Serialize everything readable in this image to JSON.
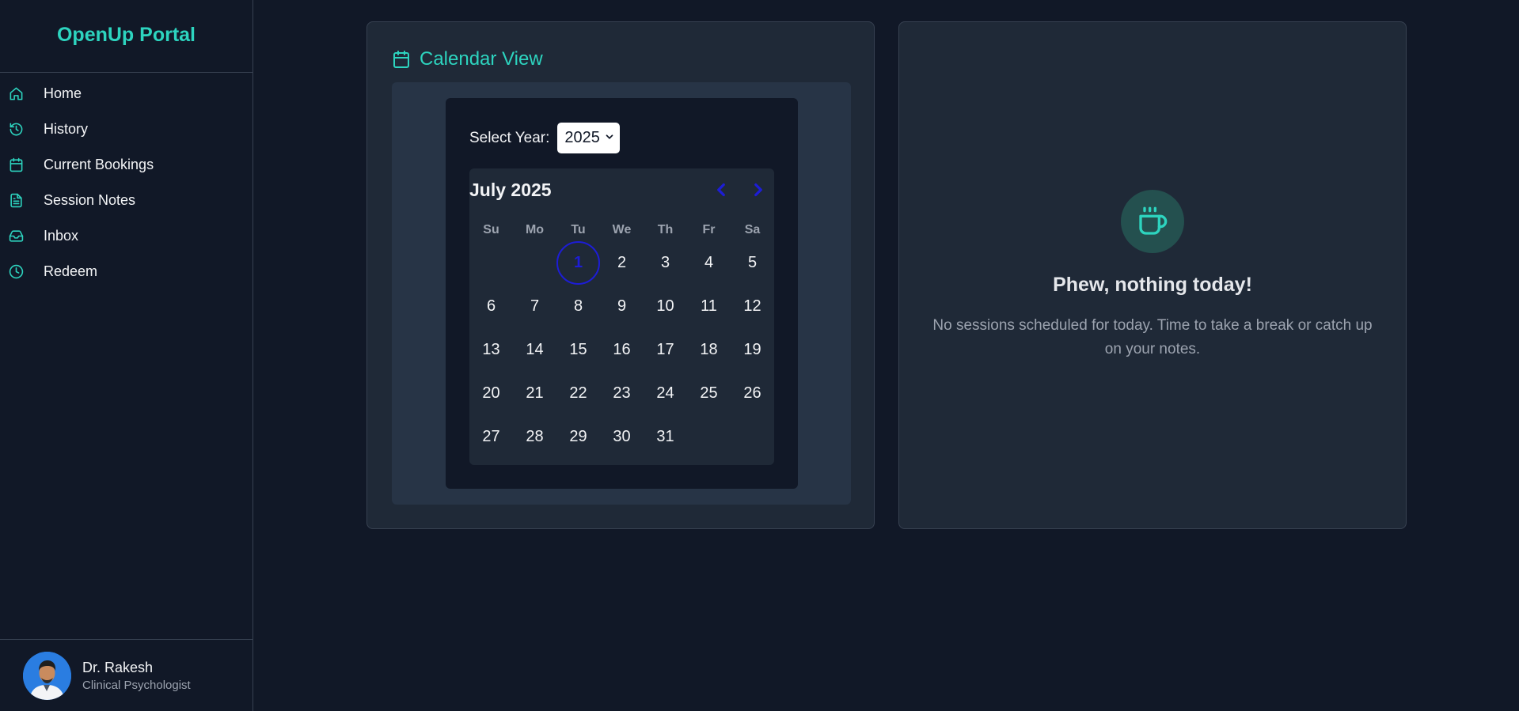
{
  "sidebar": {
    "brand": "OpenUp Portal",
    "items": [
      {
        "label": "Home",
        "icon": "home-icon"
      },
      {
        "label": "History",
        "icon": "history-icon"
      },
      {
        "label": "Current Bookings",
        "icon": "calendar-icon"
      },
      {
        "label": "Session Notes",
        "icon": "file-text-icon"
      },
      {
        "label": "Inbox",
        "icon": "inbox-icon"
      },
      {
        "label": "Redeem",
        "icon": "clock-icon"
      }
    ],
    "profile": {
      "name": "Dr. Rakesh",
      "role": "Clinical Psychologist"
    }
  },
  "calendar_card": {
    "title": "Calendar View",
    "year_label": "Select Year:",
    "year_value": "2025",
    "month_title": "July 2025",
    "weekdays": [
      "Su",
      "Mo",
      "Tu",
      "We",
      "Th",
      "Fr",
      "Sa"
    ],
    "first_weekday_index": 2,
    "days_in_month": 31,
    "today": 1
  },
  "status_card": {
    "title": "Phew, nothing today!",
    "description": "No sessions scheduled for today. Time to take a break or catch up on your notes."
  },
  "colors": {
    "background": "#111827",
    "card": "#1f2937",
    "accent": "#2dd4bf",
    "today_ring": "#1d1dd6",
    "nav_arrows": "#1d1dd6"
  }
}
